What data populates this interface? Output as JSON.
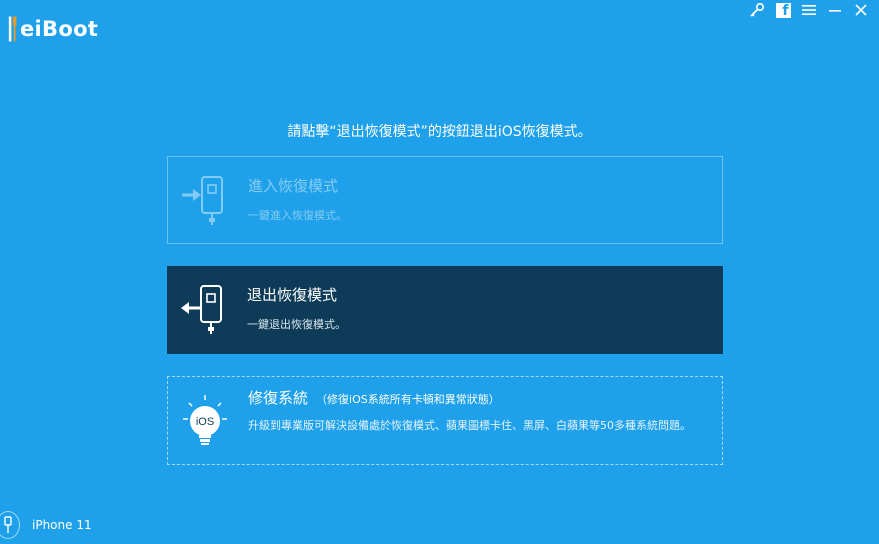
{
  "app": {
    "logo_text": "eiBoot",
    "logo_icon": "tools-logo-icon"
  },
  "window_controls": [
    "key-icon",
    "facebook-icon",
    "menu-icon",
    "minimize-icon",
    "close-icon"
  ],
  "instruction": "請點擊“退出恢復模式”的按鈕退出iOS恢復模式。",
  "options": {
    "enter": {
      "title": "進入恢復模式",
      "desc": "一鍵進入恢復模式。",
      "icon": "enter-recovery-icon",
      "state": "disabled"
    },
    "exit": {
      "title": "退出恢復模式",
      "desc": "一鍵退出恢復模式。",
      "icon": "exit-recovery-icon",
      "state": "active"
    },
    "repair": {
      "title": "修復系統",
      "subtitle": "（修復iOS系統所有卡頓和異常狀態）",
      "desc": "升級到專業版可解決設備處於恢復模式、蘋果圖標卡住、黑屏、白蘋果等50多種系統問題。",
      "icon": "ios-bulb-icon"
    }
  },
  "device": {
    "name": "iPhone 11",
    "icon": "usb-cable-icon"
  },
  "colors": {
    "background": "#1ea1ea",
    "selected_card": "#0e3b58",
    "bulb_icon_text": "iOS"
  }
}
